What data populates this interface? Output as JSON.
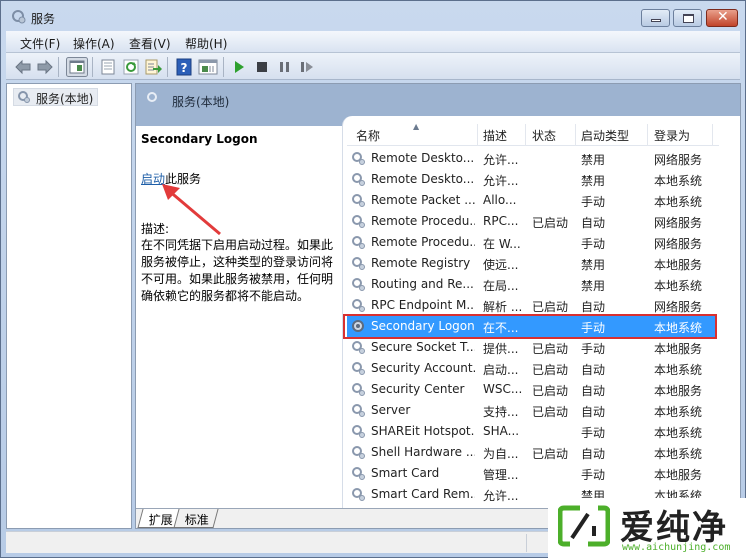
{
  "window": {
    "title": "服务",
    "controls": [
      "minimize",
      "maximize",
      "close"
    ]
  },
  "menubar": {
    "items": [
      "文件(F)",
      "操作(A)",
      "查看(V)",
      "帮助(H)"
    ]
  },
  "toolbar": {
    "buttons": [
      "back-icon",
      "forward-icon",
      "show-hide-console-tree-icon",
      "properties-icon",
      "refresh-icon",
      "export-list-icon",
      "help-icon",
      "show-hide-action-pane-icon",
      "start-service-icon",
      "stop-service-icon",
      "pause-service-icon",
      "restart-service-icon"
    ]
  },
  "tree": {
    "items": [
      {
        "label": "服务(本地)",
        "selected": true
      }
    ]
  },
  "main": {
    "header_title": "服务(本地)",
    "detail": {
      "service_name": "Secondary Logon",
      "start_link": "启动",
      "start_suffix": "此服务",
      "desc_label": "描述:",
      "desc_text": "在不同凭据下启用启动过程。如果此服务被停止，这种类型的登录访问将不可用。如果此服务被禁用，任何明确依赖它的服务都将不能启动。"
    },
    "columns": [
      "名称",
      "描述",
      "状态",
      "启动类型",
      "登录为"
    ],
    "sort_column": "名称",
    "rows": [
      {
        "name": "Remote Deskto...",
        "desc": "允许...",
        "status": "",
        "startup": "禁用",
        "logon": "网络服务"
      },
      {
        "name": "Remote Deskto...",
        "desc": "允许...",
        "status": "",
        "startup": "禁用",
        "logon": "本地系统"
      },
      {
        "name": "Remote Packet ...",
        "desc": "Allo...",
        "status": "",
        "startup": "手动",
        "logon": "本地系统"
      },
      {
        "name": "Remote Procedu...",
        "desc": "RPC...",
        "status": "已启动",
        "startup": "自动",
        "logon": "网络服务"
      },
      {
        "name": "Remote Procedu...",
        "desc": "在 W...",
        "status": "",
        "startup": "手动",
        "logon": "网络服务"
      },
      {
        "name": "Remote Registry",
        "desc": "使远...",
        "status": "",
        "startup": "禁用",
        "logon": "本地服务"
      },
      {
        "name": "Routing and Re...",
        "desc": "在局...",
        "status": "",
        "startup": "禁用",
        "logon": "本地系统"
      },
      {
        "name": "RPC Endpoint M...",
        "desc": "解析 ...",
        "status": "已启动",
        "startup": "自动",
        "logon": "网络服务"
      },
      {
        "name": "Secondary Logon",
        "desc": "在不...",
        "status": "",
        "startup": "手动",
        "logon": "本地系统",
        "selected": true
      },
      {
        "name": "Secure Socket T...",
        "desc": "提供...",
        "status": "已启动",
        "startup": "手动",
        "logon": "本地服务"
      },
      {
        "name": "Security Account...",
        "desc": "启动...",
        "status": "已启动",
        "startup": "自动",
        "logon": "本地系统"
      },
      {
        "name": "Security Center",
        "desc": "WSC...",
        "status": "已启动",
        "startup": "自动",
        "logon": "本地服务"
      },
      {
        "name": "Server",
        "desc": "支持...",
        "status": "已启动",
        "startup": "自动",
        "logon": "本地系统"
      },
      {
        "name": "SHAREit Hotspot...",
        "desc": "SHA...",
        "status": "",
        "startup": "手动",
        "logon": "本地系统"
      },
      {
        "name": "Shell Hardware ...",
        "desc": "为自...",
        "status": "已启动",
        "startup": "自动",
        "logon": "本地系统"
      },
      {
        "name": "Smart Card",
        "desc": "管理...",
        "status": "",
        "startup": "手动",
        "logon": "本地服务"
      },
      {
        "name": "Smart Card Rem...",
        "desc": "允许...",
        "status": "",
        "startup": "禁用",
        "logon": "本地系统"
      }
    ],
    "tabs": [
      {
        "label": "扩展",
        "active": true
      },
      {
        "label": "标准",
        "active": false
      }
    ]
  },
  "colors": {
    "selection": "#3399ff",
    "highlight_outline": "#d93030",
    "link": "#1f5fa8",
    "annotation_arrow": "#e23b3b",
    "pane_header": "#9db3d0"
  },
  "watermark": {
    "text": "爱纯净",
    "url": "www.aichunjing.com"
  }
}
